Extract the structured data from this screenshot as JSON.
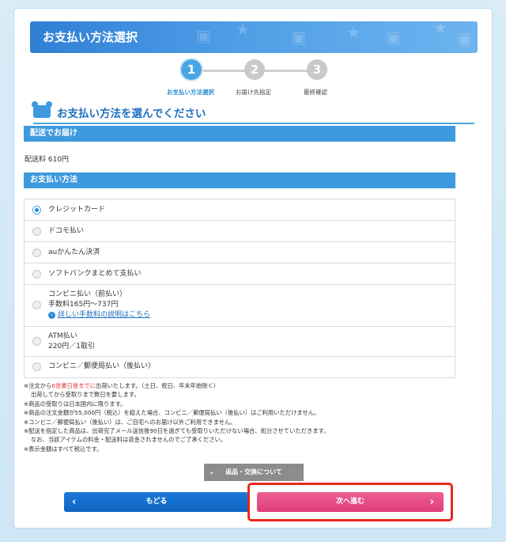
{
  "header": {
    "title": "お支払い方法選択"
  },
  "stepper": {
    "steps": [
      {
        "num": "1",
        "label": "お支払い方法選択"
      },
      {
        "num": "2",
        "label": "お届け先指定"
      },
      {
        "num": "3",
        "label": "最終確認"
      }
    ]
  },
  "section": {
    "title": "お支払い方法を選んでください"
  },
  "shipping": {
    "bar_label": "配送でお届け",
    "fee_text": "配送料 610円"
  },
  "payment": {
    "bar_label": "お支払い方法",
    "options": [
      {
        "label": "クレジットカード",
        "checked": true
      },
      {
        "label": "ドコモ払い"
      },
      {
        "label": "auかんたん決済"
      },
      {
        "label": "ソフトバンクまとめて支払い"
      },
      {
        "label": "コンビニ払い（前払い）",
        "sub": "手数料165円〜737円",
        "link": "詳しい手数料の説明はこちら"
      },
      {
        "label": "ATM払い",
        "sub": "220円／1取引"
      },
      {
        "label": "コンビニ／郵便局払い（後払い）"
      }
    ]
  },
  "notes": {
    "line1_prefix": "※注文から",
    "line1_red": "6営業日後までに",
    "line1_suffix": "出荷いたします。（土日、祝日、年末年始除く）",
    "line2": "出荷してから受取りまで数日を要します。",
    "line3": "※商品の受取りは日本国内に限ります。",
    "line4": "※商品の注文金額が55,000円（税込）を超えた場合、コンビニ／郵便局払い（後払い）はご利用いただけません。",
    "line5": "※コンビニ／郵便局払い（後払い）は、ご自宅へのお届け以外ご利用できません。",
    "line6": "※配送を指定した商品は、出荷完了メール送信後90日を過ぎても受取りいただけない場合、処分させていただきます。",
    "line7": "なお、当該アイテムの料金・配送料は返金されませんのでご了承ください。",
    "line8": "※表示金額はすべて税込です。"
  },
  "buttons": {
    "returns": "返品・交換について",
    "back": "もどる",
    "next": "次へ進む"
  },
  "colors": {
    "accent": "#3d9ade",
    "next": "#de3f7a",
    "back": "#0f65c2",
    "highlight": "#e8271d"
  }
}
